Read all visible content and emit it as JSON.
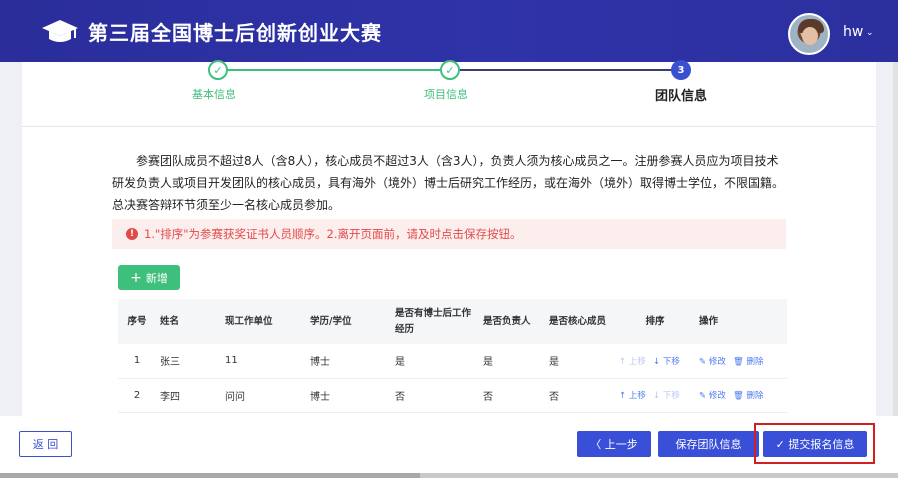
{
  "header": {
    "title": "第三届全国博士后创新创业大赛",
    "logo_icon": "graduation-cap-icon",
    "user": "hw"
  },
  "steps": [
    {
      "label": "基本信息",
      "state": "done",
      "marker": "✓"
    },
    {
      "label": "项目信息",
      "state": "done",
      "marker": "✓"
    },
    {
      "label": "团队信息",
      "state": "current",
      "marker": "3"
    }
  ],
  "notice": {
    "text": "参赛团队成员不超过8人（含8人），核心成员不超过3人（含3人），负责人须为核心成员之一。注册参赛人员应为项目技术研发负责人或项目开发团队的核心成员，具有海外（境外）博士后研究工作经历，或在海外（境外）取得博士学位，不限国籍。总决赛答辩环节须至少一名核心成员参加。"
  },
  "alert": {
    "icon": "!",
    "text": "1.\"排序\"为参赛获奖证书人员顺序。2.离开页面前，请及时点击保存按钮。"
  },
  "add_button": {
    "icon": "+",
    "label": "新增"
  },
  "table": {
    "headers": [
      "序号",
      "姓名",
      "现工作单位",
      "学历/学位",
      "是否有博士后工作经历",
      "是否负责人",
      "是否核心成员",
      "排序",
      "操作"
    ],
    "rows": [
      {
        "idx": "1",
        "name": "张三",
        "unit": "11",
        "degree": "博士",
        "exp": "是",
        "lead": "是",
        "core": "是"
      },
      {
        "idx": "2",
        "name": "李四",
        "unit": "问问",
        "degree": "博士",
        "exp": "否",
        "lead": "否",
        "core": "否"
      }
    ],
    "actions": {
      "up": "↑ 上移",
      "down": "↓ 下移",
      "edit": "✎ 修改",
      "delete": "🗑 删除"
    }
  },
  "footer": {
    "back": "返 回",
    "prev": "〈 上一步",
    "save": "保存团队信息",
    "submit": "✓ 提交报名信息"
  },
  "colors": {
    "header_bg": "#2c2f9e",
    "primary": "#3a4fd8",
    "success": "#3fbf7c",
    "danger": "#e24a4a",
    "highlight_box": "#d21f1f"
  }
}
